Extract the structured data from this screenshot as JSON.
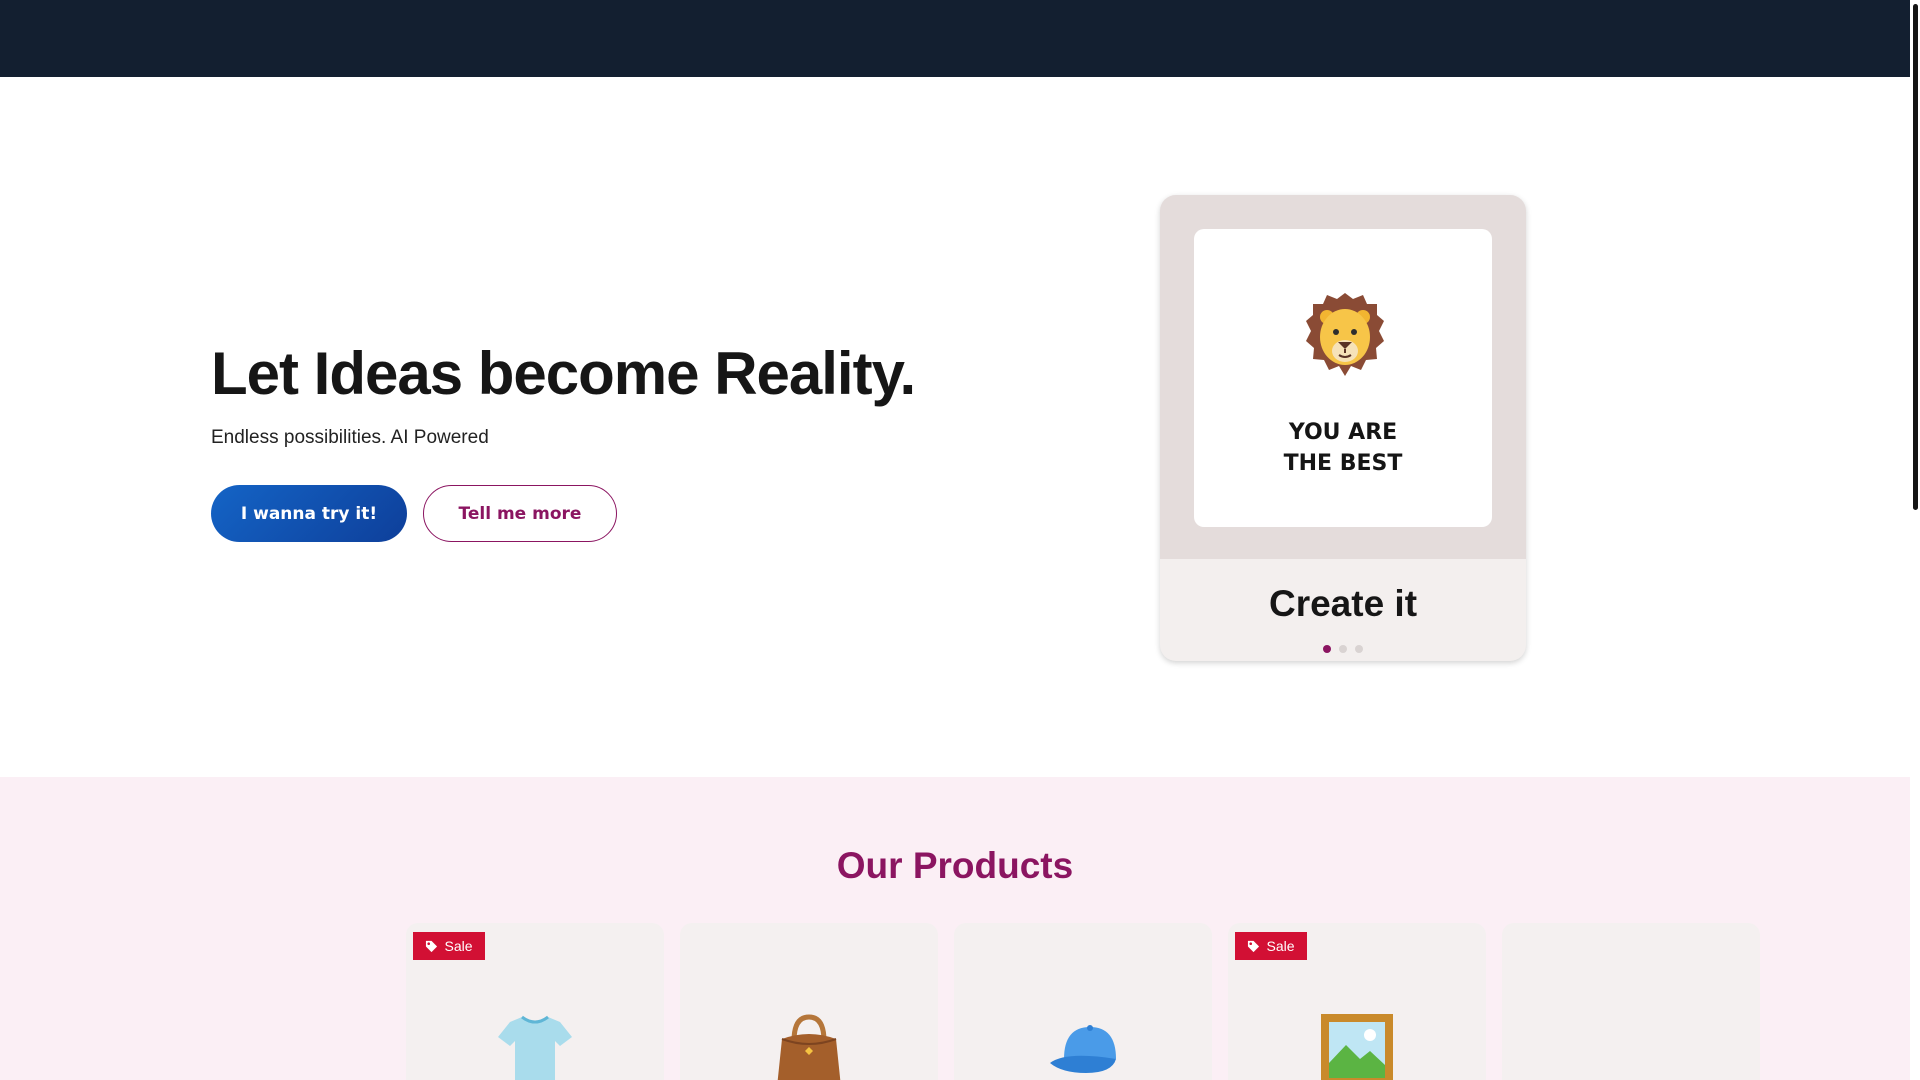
{
  "hero": {
    "title": "Let Ideas become Reality.",
    "subtitle": "Endless possibilities. AI Powered",
    "primary_button": "I wanna try it!",
    "secondary_button": "Tell me more"
  },
  "carousel": {
    "card_text_line1": "YOU ARE",
    "card_text_line2": "THE BEST",
    "caption": "Create it",
    "icon": "lion-face-icon",
    "active_slide": 1,
    "slide_count": 3
  },
  "products": {
    "title": "Our Products",
    "items": [
      {
        "icon": "t-shirt-icon",
        "badge": "Sale"
      },
      {
        "icon": "handbag-icon",
        "badge": ""
      },
      {
        "icon": "cap-icon",
        "badge": ""
      },
      {
        "icon": "framed-picture-icon",
        "badge": "Sale"
      }
    ]
  },
  "colors": {
    "nav": "#131f30",
    "primary_gradient_start": "#1464c6",
    "primary_gradient_end": "#0e3f9a",
    "accent": "#8b1561",
    "sale_badge": "#d21034",
    "products_bg": "#fbeff5"
  }
}
